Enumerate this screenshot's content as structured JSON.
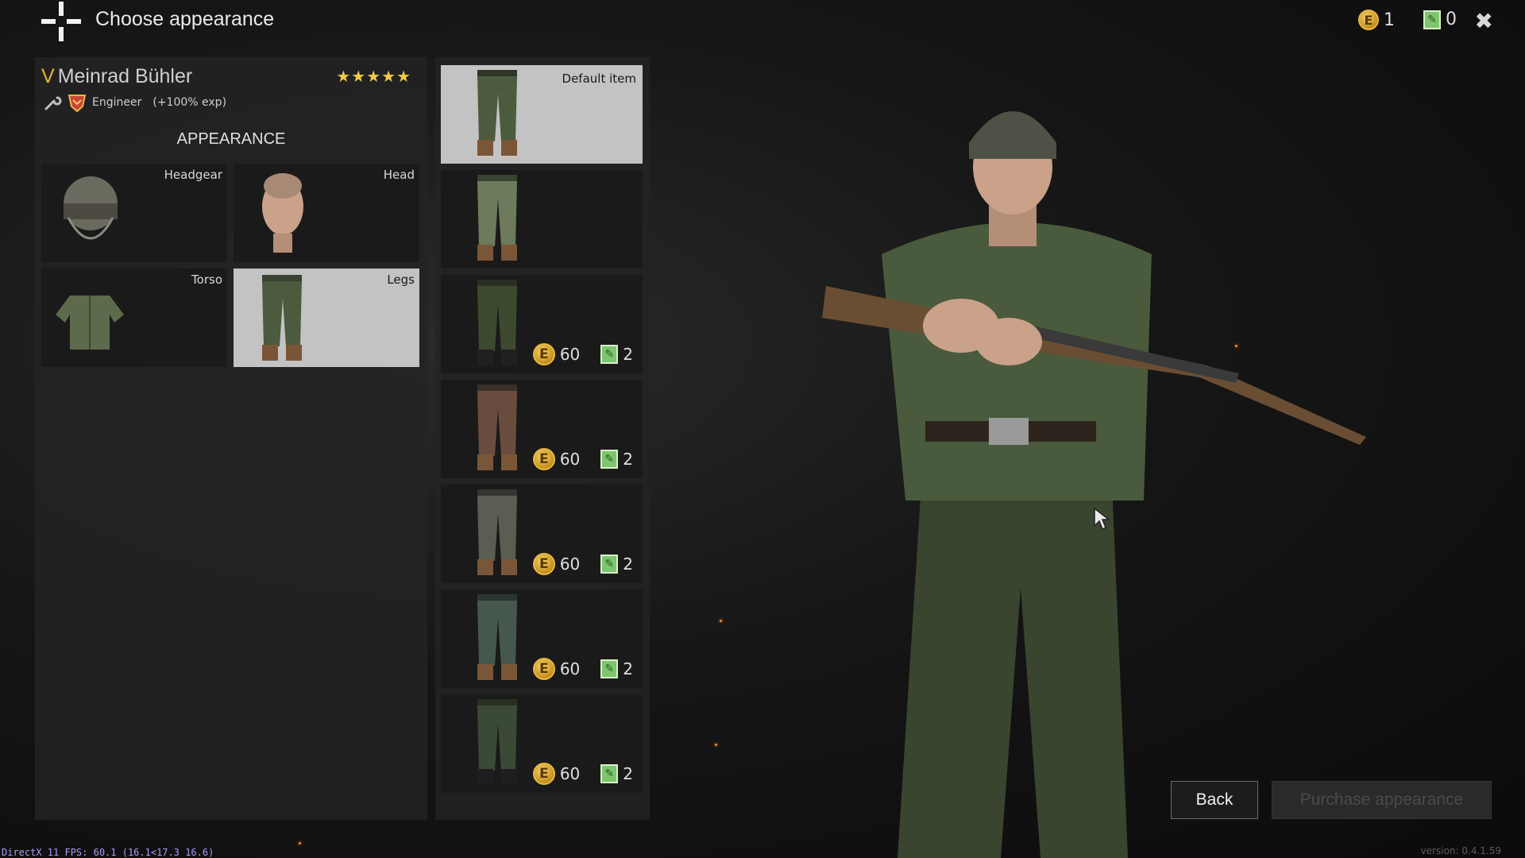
{
  "header": {
    "title": "Choose appearance",
    "close_icon": "close-icon"
  },
  "currency": {
    "silver_count": "1",
    "orders_count": "0",
    "coin_symbol": "E"
  },
  "soldier": {
    "rank": "V",
    "name": "Meinrad Bühler",
    "stars": "★★★★★",
    "class": "Engineer",
    "exp_bonus": "(+100% exp)"
  },
  "appearance": {
    "title": "APPEARANCE",
    "slots": [
      {
        "label": "Headgear",
        "icon": "helmet-icon"
      },
      {
        "label": "Head",
        "icon": "head-icon"
      },
      {
        "label": "Torso",
        "icon": "jacket-icon"
      },
      {
        "label": "Legs",
        "icon": "trousers-icon",
        "selected": true
      }
    ]
  },
  "items": [
    {
      "label": "Default item",
      "selected": true,
      "pants_color": "#4c5a3e"
    },
    {
      "label": "",
      "pants_color": "#6d7a5c"
    },
    {
      "price_coins": "60",
      "price_orders": "2",
      "pants_color": "#3d4a30"
    },
    {
      "price_coins": "60",
      "price_orders": "2",
      "pants_color": "#6a4c3e"
    },
    {
      "price_coins": "60",
      "price_orders": "2",
      "pants_color": "#5a5e52"
    },
    {
      "price_coins": "60",
      "price_orders": "2",
      "pants_color": "#46584c"
    },
    {
      "price_coins": "60",
      "price_orders": "2",
      "pants_color": "#3b4a36"
    }
  ],
  "buttons": {
    "back": "Back",
    "purchase": "Purchase appearance"
  },
  "footer": {
    "fps": "DirectX 11 FPS: 60.1 (16.1<17.3 16.6)",
    "version": "version: 0.4.1.59"
  }
}
